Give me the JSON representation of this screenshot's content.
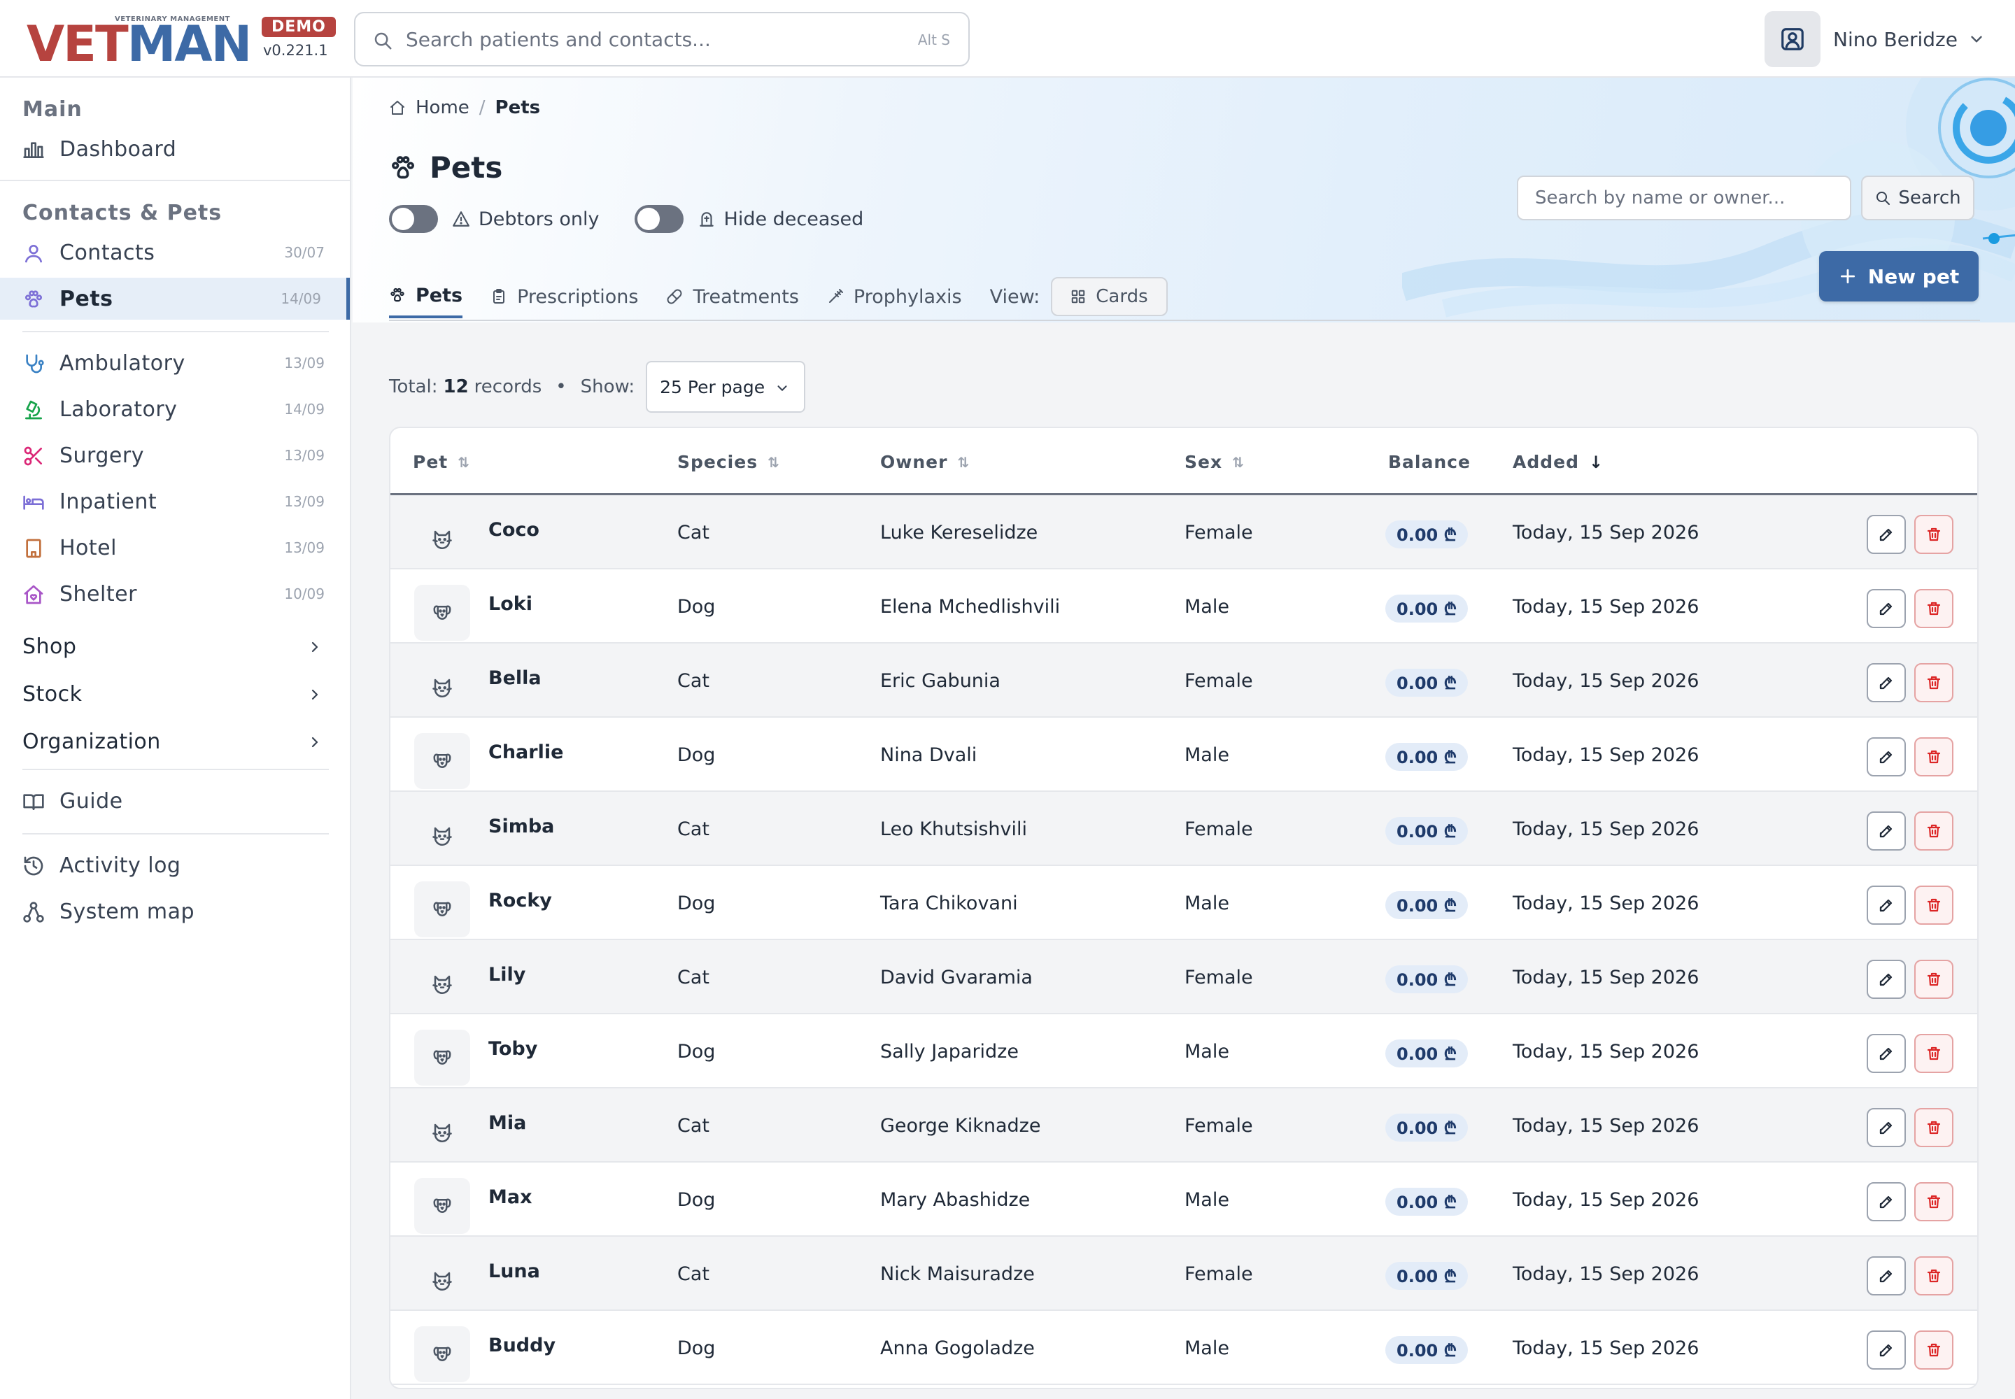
{
  "brand": {
    "tagline": "VETERINARY MANAGEMENT",
    "name_part1": "VET",
    "name_part2": "MAN",
    "badge": "DEMO",
    "version": "v0.221.1"
  },
  "global_search": {
    "placeholder": "Search patients and contacts...",
    "shortcut": "Alt S"
  },
  "user": {
    "name": "Nino Beridze",
    "icon": "user-square-icon"
  },
  "sidebar": {
    "sections": {
      "main": "Main",
      "contacts_pets": "Contacts & Pets"
    },
    "dashboard": {
      "label": "Dashboard",
      "icon": "bar-chart-icon"
    },
    "contacts": {
      "label": "Contacts",
      "count": "30/07",
      "icon": "user-icon"
    },
    "pets": {
      "label": "Pets",
      "count": "14/09",
      "icon": "paw-icon"
    },
    "modules": [
      {
        "label": "Ambulatory",
        "count": "13/09",
        "icon": "stethoscope-icon",
        "color": "#3b82c4"
      },
      {
        "label": "Laboratory",
        "count": "14/09",
        "icon": "microscope-icon",
        "color": "#16a34a"
      },
      {
        "label": "Surgery",
        "count": "13/09",
        "icon": "scissors-icon",
        "color": "#db2777"
      },
      {
        "label": "Inpatient",
        "count": "13/09",
        "icon": "bed-icon",
        "color": "#7c6fd6"
      },
      {
        "label": "Hotel",
        "count": "13/09",
        "icon": "hotel-icon",
        "color": "#c2703d"
      },
      {
        "label": "Shelter",
        "count": "10/09",
        "icon": "home-heart-icon",
        "color": "#a855c7"
      }
    ],
    "groups": {
      "shop": "Shop",
      "stock": "Stock",
      "organization": "Organization"
    },
    "guide": "Guide",
    "activity_log": "Activity log",
    "system_map": "System map"
  },
  "breadcrumb": {
    "home": "Home",
    "separator": "/",
    "current": "Pets"
  },
  "page": {
    "title": "Pets",
    "toggles": {
      "debtors": "Debtors only",
      "deceased": "Hide deceased"
    },
    "tabs": {
      "pets": "Pets",
      "prescriptions": "Prescriptions",
      "treatments": "Treatments",
      "prophylaxis": "Prophylaxis"
    },
    "view_label": "View:",
    "view_value": "Cards",
    "search_placeholder": "Search by name or owner...",
    "search_button": "Search",
    "new_button": "New pet"
  },
  "records": {
    "total_label": "Total:",
    "total": "12",
    "records_word": "records",
    "dot": "•",
    "show_label": "Show:",
    "per_page": "25 Per page"
  },
  "table": {
    "headers": {
      "pet": "Pet",
      "species": "Species",
      "owner": "Owner",
      "sex": "Sex",
      "balance": "Balance",
      "added": "Added"
    },
    "sort_icon": "⇅",
    "sort_active_icon": "↓",
    "rows": [
      {
        "name": "Coco",
        "species": "Cat",
        "owner": "Luke Kereselidze",
        "sex": "Female",
        "balance": "0.00 ₾",
        "added": "Today, 15 Sep 2026"
      },
      {
        "name": "Loki",
        "species": "Dog",
        "owner": "Elena Mchedlishvili",
        "sex": "Male",
        "balance": "0.00 ₾",
        "added": "Today, 15 Sep 2026"
      },
      {
        "name": "Bella",
        "species": "Cat",
        "owner": "Eric Gabunia",
        "sex": "Female",
        "balance": "0.00 ₾",
        "added": "Today, 15 Sep 2026"
      },
      {
        "name": "Charlie",
        "species": "Dog",
        "owner": "Nina Dvali",
        "sex": "Male",
        "balance": "0.00 ₾",
        "added": "Today, 15 Sep 2026"
      },
      {
        "name": "Simba",
        "species": "Cat",
        "owner": "Leo Khutsishvili",
        "sex": "Female",
        "balance": "0.00 ₾",
        "added": "Today, 15 Sep 2026"
      },
      {
        "name": "Rocky",
        "species": "Dog",
        "owner": "Tara Chikovani",
        "sex": "Male",
        "balance": "0.00 ₾",
        "added": "Today, 15 Sep 2026"
      },
      {
        "name": "Lily",
        "species": "Cat",
        "owner": "David Gvaramia",
        "sex": "Female",
        "balance": "0.00 ₾",
        "added": "Today, 15 Sep 2026"
      },
      {
        "name": "Toby",
        "species": "Dog",
        "owner": "Sally Japaridze",
        "sex": "Male",
        "balance": "0.00 ₾",
        "added": "Today, 15 Sep 2026"
      },
      {
        "name": "Mia",
        "species": "Cat",
        "owner": "George Kiknadze",
        "sex": "Female",
        "balance": "0.00 ₾",
        "added": "Today, 15 Sep 2026"
      },
      {
        "name": "Max",
        "species": "Dog",
        "owner": "Mary Abashidze",
        "sex": "Male",
        "balance": "0.00 ₾",
        "added": "Today, 15 Sep 2026"
      },
      {
        "name": "Luna",
        "species": "Cat",
        "owner": "Nick Maisuradze",
        "sex": "Female",
        "balance": "0.00 ₾",
        "added": "Today, 15 Sep 2026"
      },
      {
        "name": "Buddy",
        "species": "Dog",
        "owner": "Anna Gogoladze",
        "sex": "Male",
        "balance": "0.00 ₾",
        "added": "Today, 15 Sep 2026"
      }
    ]
  },
  "colors": {
    "accent": "#3d6aa6",
    "brand_red": "#b6433f",
    "danger": "#dc2626"
  }
}
